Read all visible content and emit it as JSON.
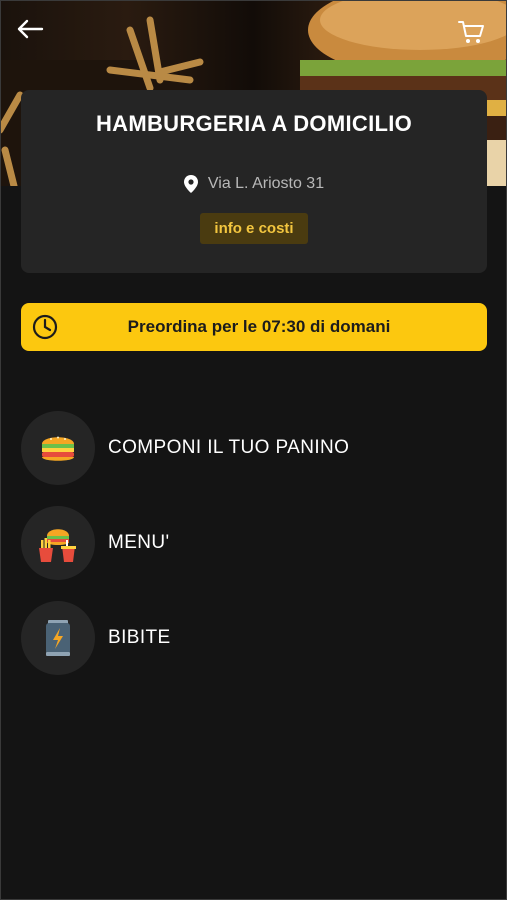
{
  "header": {
    "back_icon": "arrow-left-icon",
    "cart_icon": "cart-icon"
  },
  "restaurant": {
    "name": "HAMBURGERIA A DOMICILIO",
    "address_icon": "location-pin-icon",
    "address": "Via L. Ariosto 31",
    "info_button": "info e costi"
  },
  "preorder": {
    "icon": "clock-icon",
    "prefix": "Preordina per le",
    "time": "07:30",
    "suffix": "di domani"
  },
  "categories": [
    {
      "label": "COMPONI IL TUO PANINO",
      "icon": "burger-icon"
    },
    {
      "label": "MENU'",
      "icon": "burger-fries-drink-icon"
    },
    {
      "label": "BIBITE",
      "icon": "energy-can-icon"
    }
  ],
  "colors": {
    "background": "#141414",
    "card": "#252525",
    "accent": "#fcc80f",
    "info_button_bg": "#4a3b10",
    "info_button_text": "#f3c63f"
  }
}
